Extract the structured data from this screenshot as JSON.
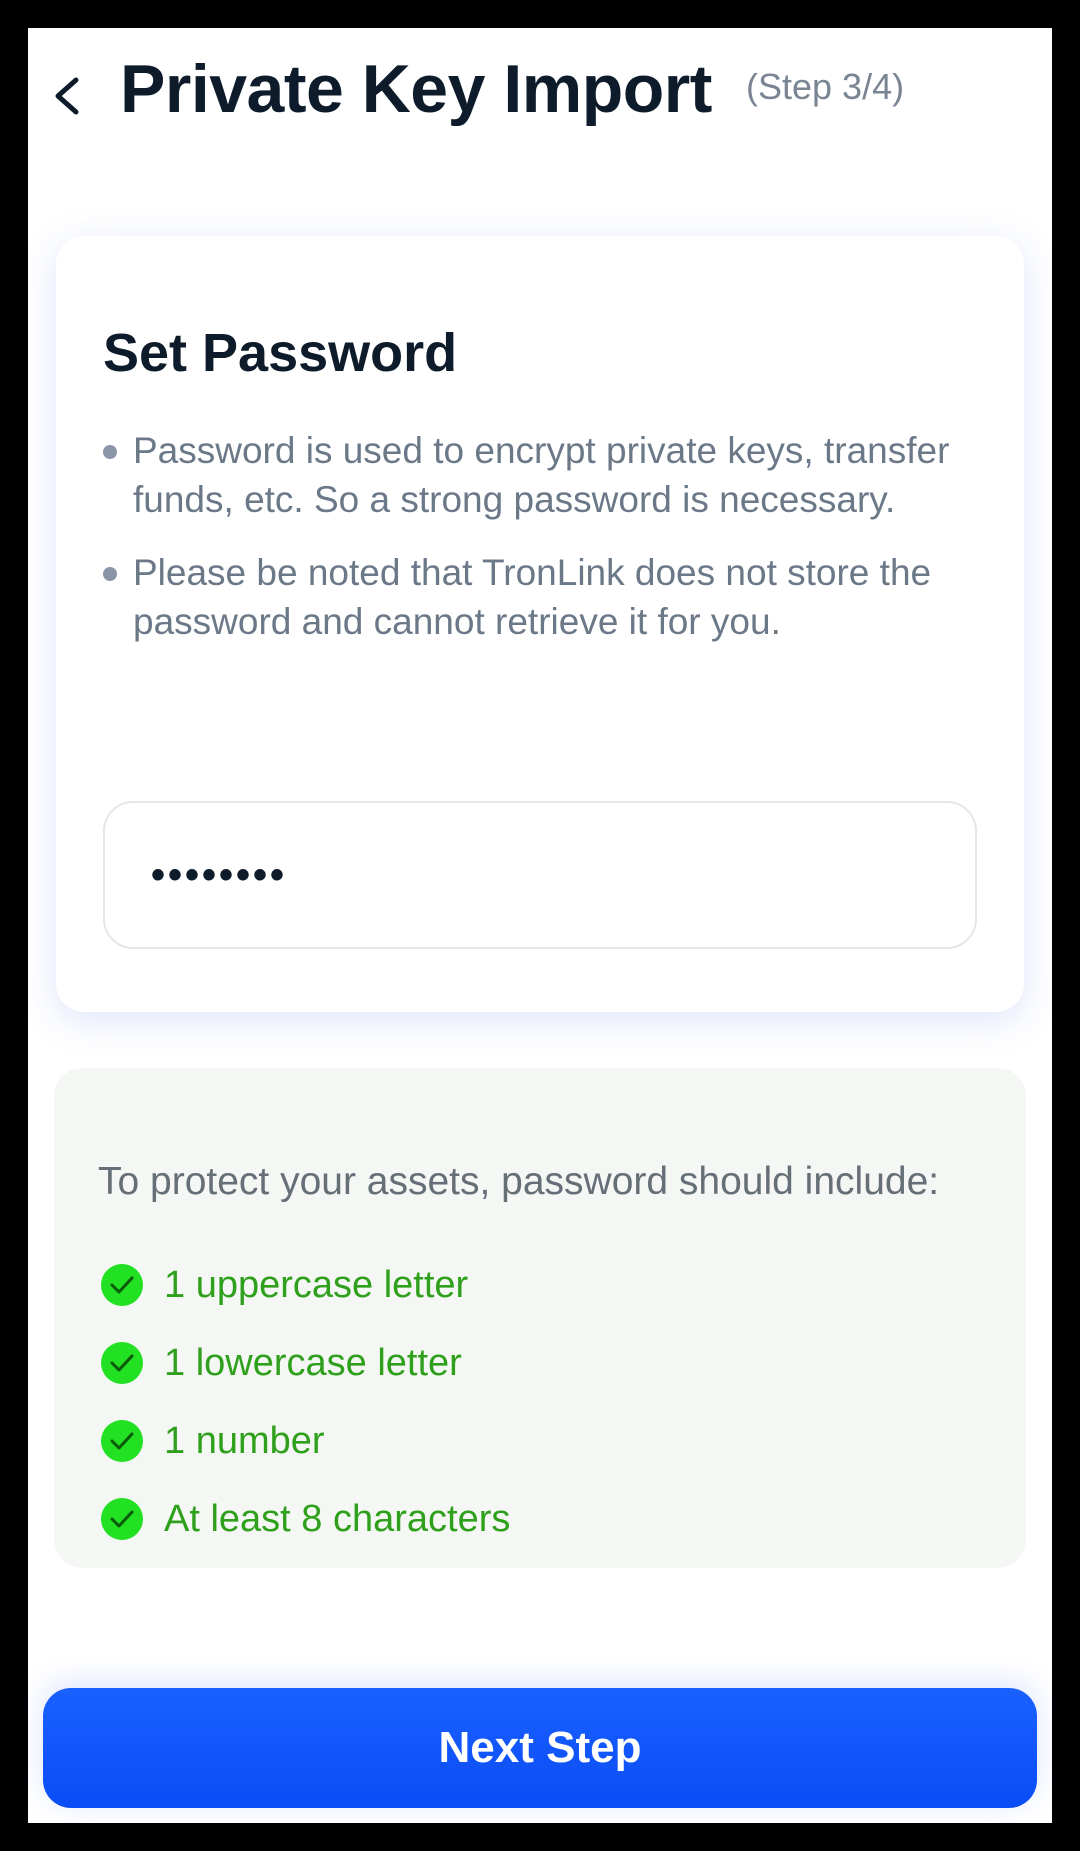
{
  "header": {
    "title": "Private Key Import",
    "step": "(Step 3/4)",
    "back_icon": "chevron-left-icon"
  },
  "card": {
    "title": "Set Password",
    "bullets": [
      "Password is used to encrypt private keys, transfer funds, etc. So a strong password is necessary.",
      "Please be noted that TronLink does not store the password and cannot retrieve it for you."
    ],
    "password_value": "••••••••"
  },
  "requirements": {
    "heading": "To protect your assets, password should include:",
    "items": [
      "1 uppercase letter",
      "1 lowercase letter",
      "1 number",
      "At least 8 characters"
    ],
    "icon": "check-circle-icon",
    "check_color": "#22e022",
    "text_color": "#2fa01c"
  },
  "footer": {
    "next_label": "Next Step"
  },
  "colors": {
    "primary": "#0a4df5",
    "title": "#0d1b2a",
    "muted": "#6b7888"
  }
}
